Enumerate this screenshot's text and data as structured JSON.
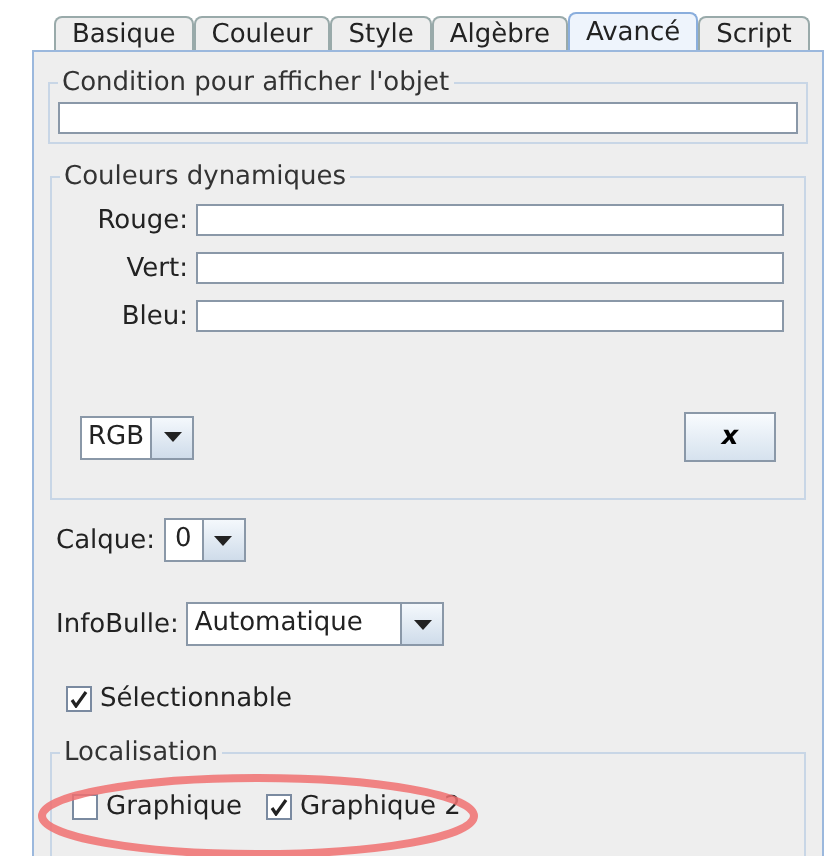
{
  "tabs": [
    {
      "label": "Basique",
      "selected": false
    },
    {
      "label": "Couleur",
      "selected": false
    },
    {
      "label": "Style",
      "selected": false
    },
    {
      "label": "Algèbre",
      "selected": false
    },
    {
      "label": "Avancé",
      "selected": true
    },
    {
      "label": "Script",
      "selected": false
    }
  ],
  "condition": {
    "title": "Condition pour afficher l'objet"
  },
  "dynamic_colors": {
    "title": "Couleurs dynamiques",
    "fields": [
      {
        "label": "Rouge:"
      },
      {
        "label": "Vert:"
      },
      {
        "label": "Bleu:"
      }
    ],
    "mode": "RGB",
    "clear_button": "x"
  },
  "layer": {
    "label": "Calque:",
    "value": "0"
  },
  "tooltip": {
    "label": "InfoBulle:",
    "value": "Automatique"
  },
  "selectable": {
    "label": "Sélectionnable",
    "checked": true
  },
  "location": {
    "title": "Localisation",
    "options": [
      {
        "label": "Graphique",
        "checked": false
      },
      {
        "label": "Graphique 2",
        "checked": true
      }
    ]
  }
}
